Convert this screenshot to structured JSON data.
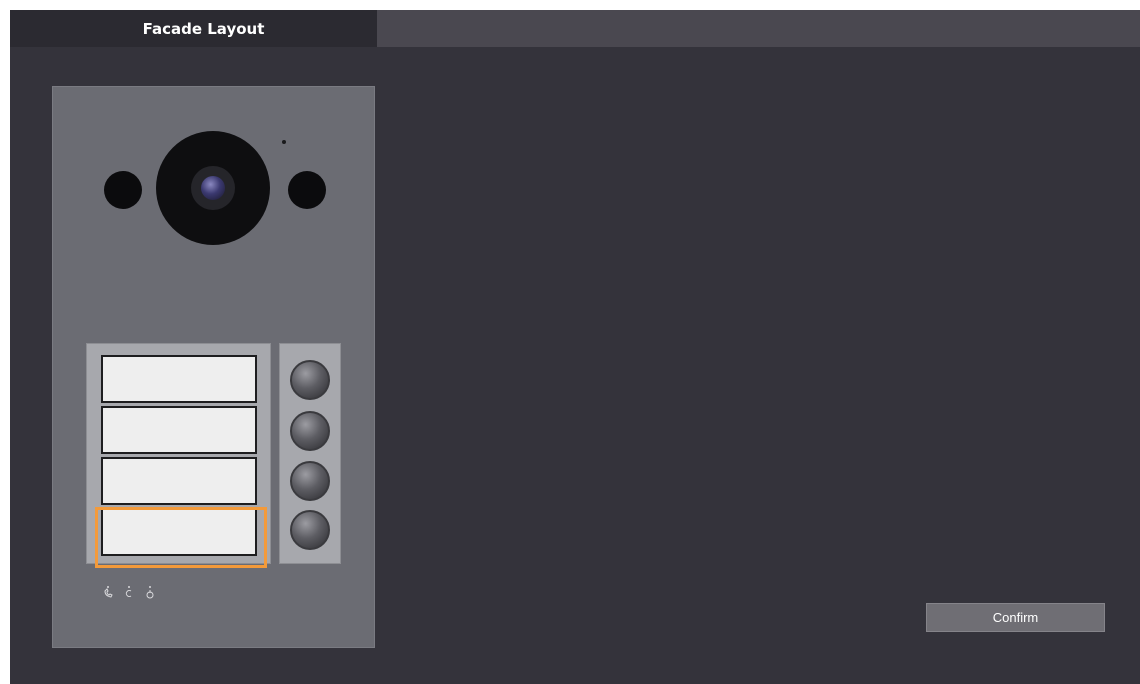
{
  "tab": {
    "title": "Facade Layout"
  },
  "device": {
    "name_cards": [
      "",
      "",
      "",
      ""
    ],
    "selected_card_index": 3,
    "call_buttons": 4,
    "indicator_icons": [
      "phone-icon",
      "door-icon",
      "lock-icon"
    ]
  },
  "actions": {
    "confirm_label": "Confirm"
  },
  "colors": {
    "background": "#34333b",
    "selection": "#f39a3a",
    "header": "#4a4850",
    "tab": "#2b2a31"
  }
}
